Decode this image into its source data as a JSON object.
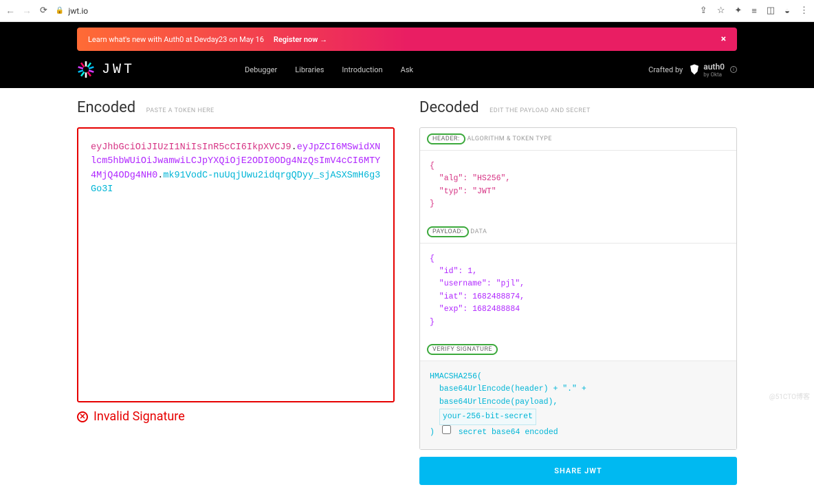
{
  "browser": {
    "url": "jwt.io"
  },
  "banner": {
    "text": "Learn what's new with Auth0 at Devday23 on May 16",
    "link": "Register now →"
  },
  "nav": {
    "logo_text": "JWT",
    "items": [
      "Debugger",
      "Libraries",
      "Introduction",
      "Ask"
    ],
    "crafted_by": "Crafted by",
    "auth0": "auth0",
    "by_okta": "by Okta"
  },
  "encoded": {
    "title": "Encoded",
    "sub": "PASTE A TOKEN HERE",
    "token_header": "eyJhbGciOiJIUzI1NiIsInR5cCI6IkpXVCJ9",
    "token_payload": "eyJpZCI6MSwidXNlcm5hbWUiOiJwamwiLCJpYXQiOjE2ODI0ODg4NzQsImV4cCI6MTY4MjQ4ODg4NH0",
    "token_sig": "mk91VodC-nuUqjUwu2idqrgQDyy_sjASXSmH6g3Go3I"
  },
  "decoded": {
    "title": "Decoded",
    "sub": "EDIT THE PAYLOAD AND SECRET",
    "header_tag": "HEADER:",
    "header_desc": "ALGORITHM & TOKEN TYPE",
    "payload_tag": "PAYLOAD:",
    "payload_desc": "DATA",
    "verify_tag": "VERIFY SIGNATURE",
    "header_json": {
      "alg": "HS256",
      "typ": "JWT"
    },
    "payload_json": {
      "id": 1,
      "username": "pjl",
      "iat": 1682488874,
      "exp": 1682488884
    },
    "sig": {
      "fn": "HMACSHA256(",
      "line1": "base64UrlEncode(header) + \".\" +",
      "line2": "base64UrlEncode(payload),",
      "secret_placeholder": "your-256-bit-secret",
      "close": ")",
      "cb_label": "secret base64 encoded"
    }
  },
  "status": {
    "text": "Invalid Signature"
  },
  "share": {
    "label": "SHARE JWT"
  },
  "watermark": "@51CTO博客"
}
